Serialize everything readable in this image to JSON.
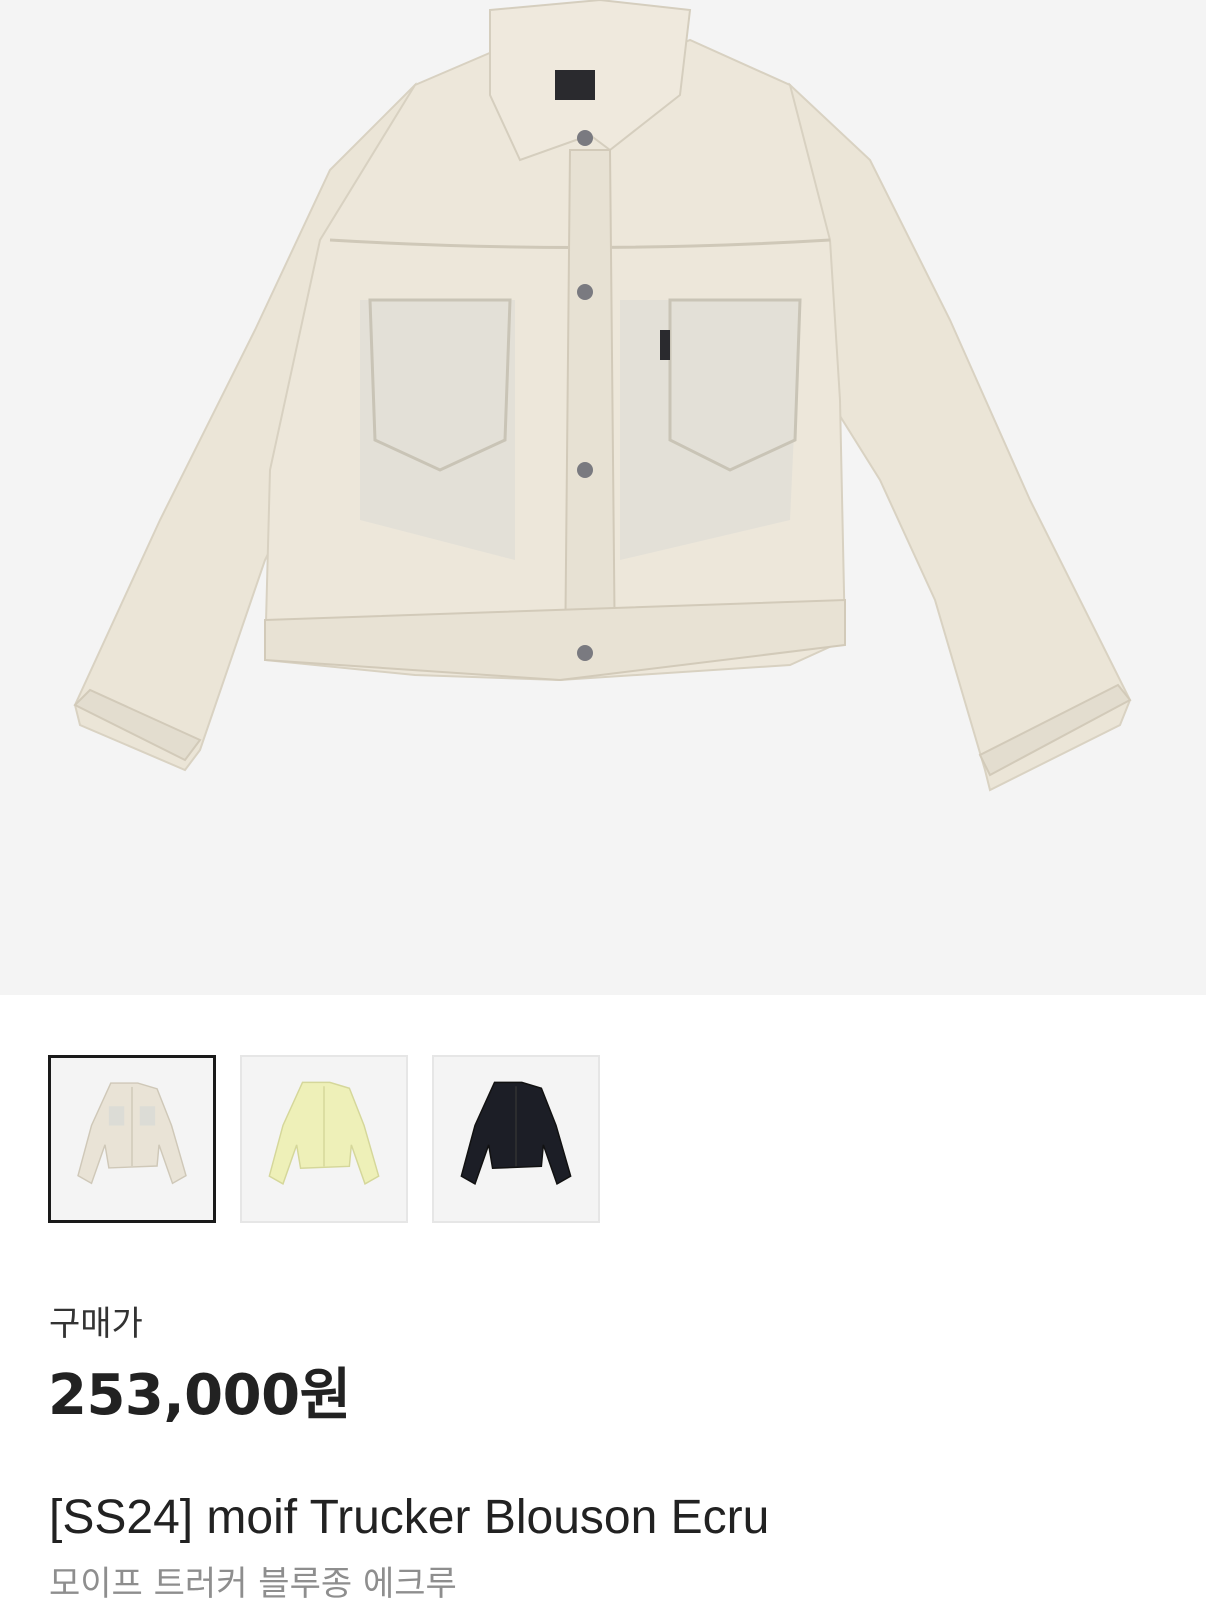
{
  "product": {
    "price_label": "구매가",
    "price": "253,000원",
    "title": "[SS24] moif Trucker Blouson Ecru",
    "subtitle": "모이프 트러커 블루종 에크루"
  },
  "hero": {
    "icon": "jacket-ecru-image",
    "color": "#ece6d8"
  },
  "thumbnails": [
    {
      "name": "Ecru",
      "color": "#e9e3d6",
      "selected": true
    },
    {
      "name": "Lime",
      "color": "#eef0b8",
      "selected": false
    },
    {
      "name": "Black",
      "color": "#1c1e26",
      "selected": false
    }
  ]
}
